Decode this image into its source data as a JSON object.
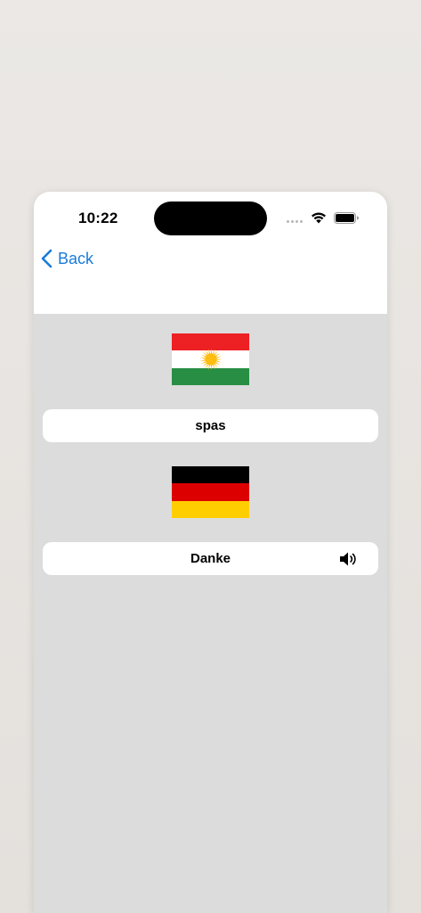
{
  "status_bar": {
    "time": "10:22"
  },
  "nav": {
    "back_label": "Back"
  },
  "source": {
    "flag_icon": "kurdistan-flag",
    "text": "spas"
  },
  "target": {
    "flag_icon": "germany-flag",
    "text": "Danke",
    "audio_icon": "speaker-icon"
  },
  "colors": {
    "accent": "#1a7bd9",
    "content_bg": "#dcdcdc",
    "kurd_red": "#ed2024",
    "kurd_white": "#ffffff",
    "kurd_green": "#278e43",
    "kurd_sun": "#febd11",
    "de_black": "#000000",
    "de_red": "#dd0000",
    "de_gold": "#ffce00"
  }
}
